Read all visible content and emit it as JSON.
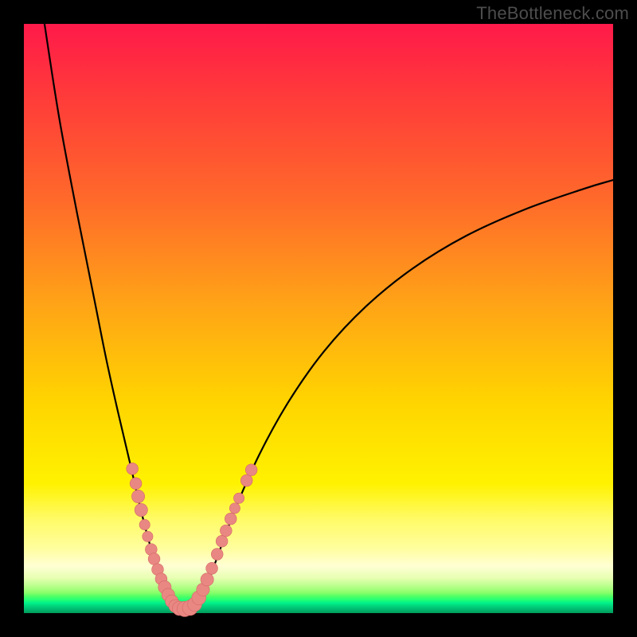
{
  "watermark": {
    "text": "TheBottleneck.com"
  },
  "colors": {
    "marker_fill": "#e98783",
    "marker_stroke": "#d46a66",
    "curve_stroke": "#000000"
  },
  "chart_data": {
    "type": "line",
    "title": "",
    "xlabel": "",
    "ylabel": "",
    "xlim": [
      0,
      100
    ],
    "ylim": [
      0,
      100
    ],
    "grid": false,
    "legend": false,
    "note": "Axes have no visible tick labels. x is normalized horizontal position (0=left, 100=right of plot area). y is normalized bottleneck percentage (0 at bottom/green, 100 at top/red). Values estimated from pixel positions.",
    "series": [
      {
        "name": "left-branch",
        "x": [
          3.5,
          6,
          9,
          12,
          14,
          16,
          18,
          19.5,
          21,
          22.5,
          24,
          25,
          25.6
        ],
        "y": [
          100,
          84,
          68,
          53,
          43,
          34,
          25.5,
          19,
          13,
          8,
          4,
          1.5,
          0.6
        ]
      },
      {
        "name": "floor",
        "x": [
          25.6,
          26.6,
          27.6,
          28.6,
          29.3
        ],
        "y": [
          0.6,
          0.5,
          0.5,
          0.6,
          0.9
        ]
      },
      {
        "name": "right-branch",
        "x": [
          29.3,
          31,
          33,
          36,
          40,
          45,
          51,
          58,
          66,
          75,
          85,
          95,
          100
        ],
        "y": [
          0.9,
          4.5,
          10,
          18,
          27,
          36,
          44.5,
          52,
          58.5,
          64,
          68.5,
          72,
          73.5
        ]
      }
    ],
    "markers": {
      "name": "highlighted-points",
      "note": "Pink circular markers clustered near the valley on both branches. Radii ~0.9–1.3 in x-units.",
      "points": [
        {
          "x": 18.4,
          "y": 24.5,
          "r": 1.0
        },
        {
          "x": 19.0,
          "y": 22.0,
          "r": 1.0
        },
        {
          "x": 19.4,
          "y": 19.8,
          "r": 1.1
        },
        {
          "x": 19.9,
          "y": 17.5,
          "r": 1.1
        },
        {
          "x": 20.5,
          "y": 15.0,
          "r": 0.9
        },
        {
          "x": 21.0,
          "y": 13.0,
          "r": 0.9
        },
        {
          "x": 21.6,
          "y": 10.8,
          "r": 1.0
        },
        {
          "x": 22.1,
          "y": 9.2,
          "r": 1.0
        },
        {
          "x": 22.7,
          "y": 7.4,
          "r": 1.0
        },
        {
          "x": 23.3,
          "y": 5.8,
          "r": 1.0
        },
        {
          "x": 23.9,
          "y": 4.4,
          "r": 1.1
        },
        {
          "x": 24.5,
          "y": 3.1,
          "r": 1.1
        },
        {
          "x": 25.1,
          "y": 2.0,
          "r": 1.1
        },
        {
          "x": 25.7,
          "y": 1.2,
          "r": 1.1
        },
        {
          "x": 26.4,
          "y": 0.8,
          "r": 1.2
        },
        {
          "x": 27.3,
          "y": 0.7,
          "r": 1.3
        },
        {
          "x": 28.2,
          "y": 0.9,
          "r": 1.3
        },
        {
          "x": 29.0,
          "y": 1.5,
          "r": 1.2
        },
        {
          "x": 29.7,
          "y": 2.6,
          "r": 1.2
        },
        {
          "x": 30.4,
          "y": 4.0,
          "r": 1.1
        },
        {
          "x": 31.1,
          "y": 5.7,
          "r": 1.1
        },
        {
          "x": 31.9,
          "y": 7.6,
          "r": 1.0
        },
        {
          "x": 32.8,
          "y": 10.0,
          "r": 1.0
        },
        {
          "x": 33.6,
          "y": 12.2,
          "r": 1.0
        },
        {
          "x": 34.3,
          "y": 14.0,
          "r": 1.0
        },
        {
          "x": 35.1,
          "y": 16.0,
          "r": 1.0
        },
        {
          "x": 35.8,
          "y": 17.8,
          "r": 0.9
        },
        {
          "x": 36.5,
          "y": 19.5,
          "r": 0.9
        },
        {
          "x": 37.8,
          "y": 22.5,
          "r": 1.0
        },
        {
          "x": 38.6,
          "y": 24.3,
          "r": 1.0
        }
      ]
    }
  }
}
